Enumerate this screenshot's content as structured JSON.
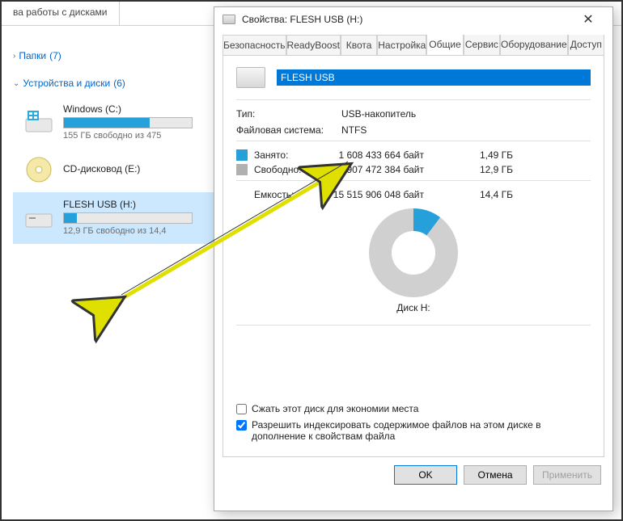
{
  "explorer": {
    "tab_title": "ва работы с дисками",
    "folders": {
      "label": "Папки",
      "count": "(7)",
      "expanded": false
    },
    "devices": {
      "label": "Устройства и диски",
      "count": "(6)",
      "expanded": true
    },
    "drives": [
      {
        "name": "Windows (C:)",
        "sub": "155 ГБ свободно из 475",
        "fill": 67
      },
      {
        "name": "CD-дисковод (E:)",
        "sub": "",
        "fill": null
      },
      {
        "name": "FLESH USB (H:)",
        "sub": "12,9 ГБ свободно из 14,4",
        "fill": 10
      }
    ]
  },
  "dialog": {
    "title": "Свойства: FLESH USB (H:)",
    "tabs_row1": [
      "Безопасность",
      "ReadyBoost",
      "Квота",
      "Настройка"
    ],
    "tabs_row2": [
      "Общие",
      "Сервис",
      "Оборудование",
      "Доступ"
    ],
    "active_tab": "Общие",
    "drive_name": "FLESH USB",
    "type_label": "Тип:",
    "type_value": "USB-накопитель",
    "fs_label": "Файловая система:",
    "fs_value": "NTFS",
    "used_label": "Занято:",
    "used_bytes": "1 608 433 664 байт",
    "used_gb": "1,49 ГБ",
    "free_label": "Свободно:",
    "free_bytes": "13 907 472 384 байт",
    "free_gb": "12,9 ГБ",
    "cap_label": "Емкость:",
    "cap_bytes": "15 515 906 048 байт",
    "cap_gb": "14,4 ГБ",
    "disk_label": "Диск H:",
    "compress_label": "Сжать этот диск для экономии места",
    "index_label": "Разрешить индексировать содержимое файлов на этом диске в дополнение к свойствам файла",
    "btn_ok": "OK",
    "btn_cancel": "Отмена",
    "btn_apply": "Применить"
  }
}
